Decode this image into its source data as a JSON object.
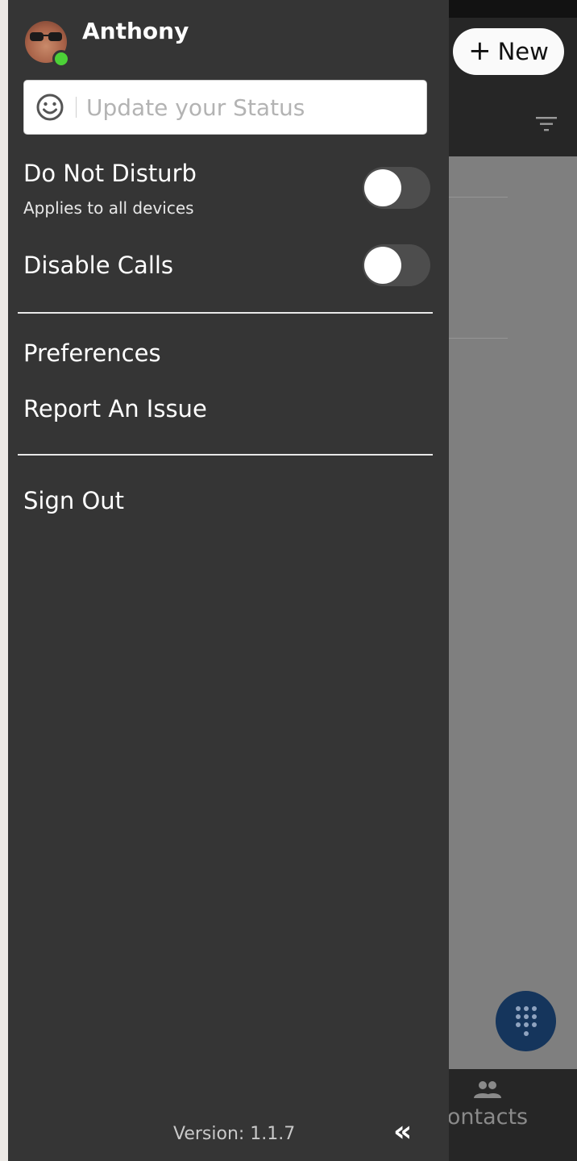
{
  "background": {
    "new_button_label": "New",
    "new_button_icon": "plus-icon",
    "filter_icon": "filter-icon",
    "dialpad_icon": "dialpad-icon",
    "bottom_tab_label": "ontacts",
    "bottom_tab_icon": "contacts-icon"
  },
  "drawer": {
    "user": {
      "name": "Anthony",
      "presence": "online",
      "presence_color": "#4cd137"
    },
    "status_input": {
      "placeholder": "Update your Status",
      "value": "",
      "icon": "smiley-icon"
    },
    "dnd": {
      "title": "Do Not Disturb",
      "subtitle": "Applies to all devices",
      "enabled": false
    },
    "disable_calls": {
      "title": "Disable Calls",
      "enabled": false
    },
    "menu": {
      "preferences": "Preferences",
      "report_issue": "Report An Issue",
      "sign_out": "Sign Out"
    },
    "version": "Version: 1.1.7",
    "collapse_icon": "double-chevron-left-icon"
  },
  "colors": {
    "drawer_bg": "#353535",
    "fab_bg": "#15355c",
    "toggle_track": "#4d4d4d"
  }
}
